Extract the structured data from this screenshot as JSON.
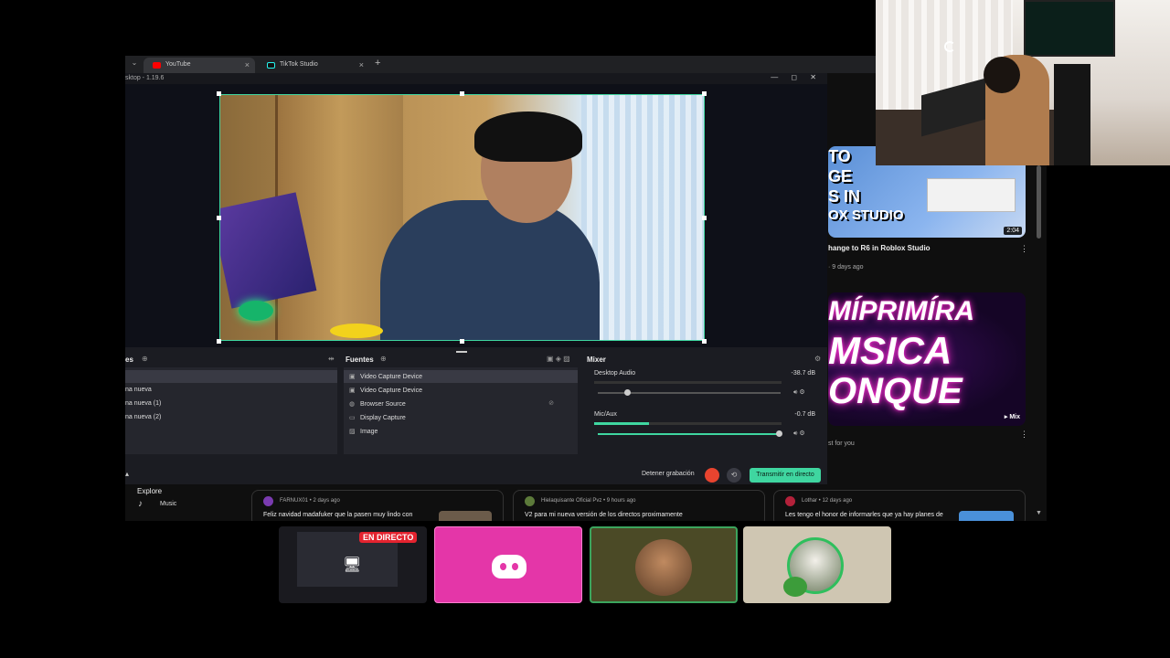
{
  "browser": {
    "tabs": [
      {
        "label": "YouTube",
        "close": "×"
      },
      {
        "label": "TikTok Studio",
        "close": "×"
      }
    ],
    "new_tab": "+",
    "dropdown": "⌄"
  },
  "youtube": {
    "videos": [
      {
        "thumb_text": "TO\nGE\nS IN",
        "thumb_line2": "OX STUDIO",
        "duration": "2:04",
        "title": "hange to R6 in Roblox Studio",
        "meta": "· 9 days ago"
      },
      {
        "thumb_line1": "MÍPRIMÍRA",
        "thumb_line2": "MSICA",
        "thumb_line3": "ONQUE",
        "badge": "▸ Mix",
        "meta": "st for you"
      }
    ],
    "explore": "Explore",
    "music": "Music",
    "posts": [
      {
        "author": "FARNUX01 • 2 days ago",
        "text": "Feliz navidad madafuker que la pasen muy lindo con",
        "avatar_color": "#7a3bb0"
      },
      {
        "author": "Hielaquisante Oficial Pvz • 9 hours ago",
        "text": "V2 para mi nueva versión de los directos proximamente",
        "avatar_color": "#5c7a3a"
      },
      {
        "author": "Lothar • 12 days ago",
        "text": "Les tengo el honor de informarles que ya hay planes de",
        "avatar_color": "#b3213a"
      }
    ]
  },
  "obs": {
    "title": "sktop - 1.19.6",
    "window_controls": "— ◻ ✕",
    "scenes_header": "es",
    "scenes": [
      "",
      "na nueva",
      "na nueva (1)",
      "na nueva (2)"
    ],
    "sources_header": "Fuentes",
    "sources": [
      {
        "icon": "▣",
        "label": "Video Capture Device"
      },
      {
        "icon": "▣",
        "label": "Video Capture Device"
      },
      {
        "icon": "◍",
        "label": "Browser Source"
      },
      {
        "icon": "▭",
        "label": "Display Capture"
      },
      {
        "icon": "▨",
        "label": "Image"
      }
    ],
    "mixer_header": "Mixer",
    "mixer": [
      {
        "name": "Desktop Audio",
        "db": "-38.7 dB",
        "level": 0.16
      },
      {
        "name": "Mic/Aux",
        "db": "-0.7 dB",
        "level": 0.99
      }
    ],
    "stop_recording": "Detener grabación",
    "go_live": "Transmitir en directo"
  },
  "discord": {
    "live_badge": "EN DIRECTO"
  },
  "colors": {
    "accent": "#3fd6a0",
    "record": "#e8442f",
    "discord_pink": "#e436a8",
    "speaking_green": "#3ba55d"
  }
}
